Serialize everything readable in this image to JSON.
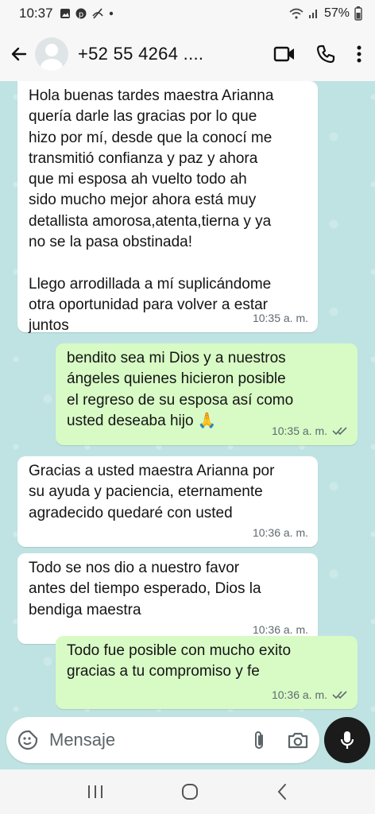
{
  "status_bar": {
    "time": "10:37",
    "battery": "57%",
    "icons": [
      "gallery-icon",
      "pinterest-icon",
      "sync-off-icon",
      "dot-icon",
      "wifi-icon",
      "signal-icon",
      "battery-icon"
    ]
  },
  "header": {
    "contact": "+52 55 4264 ....",
    "icons": [
      "back-arrow-icon",
      "avatar",
      "video-call-icon",
      "phone-icon",
      "more-vert-icon"
    ]
  },
  "messages": [
    {
      "direction": "in",
      "text": "Hola buenas tardes maestra Arianna\nquería darle las gracias por lo que\nhizo por mí, desde que la conocí me\ntransmitió confianza y paz y ahora\nque mi esposa ah vuelto todo ah\nsido mucho mejor ahora está muy\ndetallista amorosa,atenta,tierna y ya\nno se la pasa obstinada!\n\nLlego arrodillada a mí suplicándome\notra oportunidad para volver a estar\njuntos",
      "time": "10:35 a. m."
    },
    {
      "direction": "out",
      "text": "bendito sea mi Dios y a nuestros\nángeles quienes hicieron posible\nel regreso de su esposa así como\nusted deseaba hijo 🙏",
      "time": "10:35 a. m."
    },
    {
      "direction": "in",
      "text": "Gracias a usted maestra Arianna por\nsu ayuda y paciencia, eternamente\nagradecido quedaré con usted",
      "time": "10:36 a. m."
    },
    {
      "direction": "in",
      "text": "Todo se nos dio a nuestro favor\nantes del tiempo esperado, Dios la\nbendiga maestra",
      "time": "10:36 a. m."
    },
    {
      "direction": "out",
      "text": "Todo fue posible con mucho exito\ngracias a tu compromiso y fe",
      "time": "10:36 a. m."
    }
  ],
  "composer": {
    "placeholder": "Mensaje",
    "icons": [
      "emoji-sticker-icon",
      "attach-icon",
      "camera-icon",
      "mic-icon"
    ]
  },
  "nav": {
    "icons": [
      "recent-apps-icon",
      "home-icon",
      "back-icon"
    ]
  },
  "colors": {
    "chat_background": "#bfe3e2",
    "incoming_bubble": "#ffffff",
    "outgoing_bubble": "#d8fbc6",
    "read_tick": "#5e6a6f"
  }
}
